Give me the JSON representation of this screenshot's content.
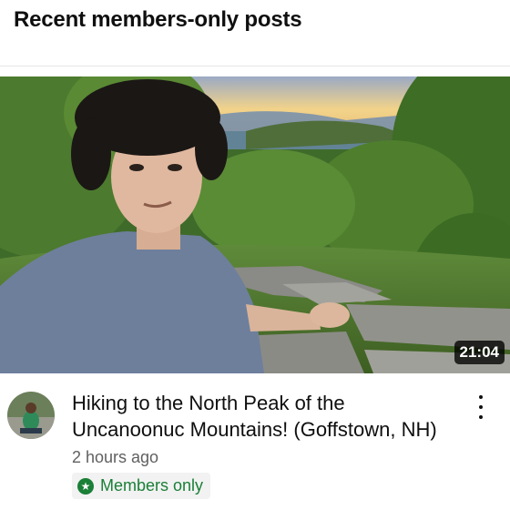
{
  "section": {
    "title": "Recent members-only posts"
  },
  "video": {
    "title": "Hiking to the North Peak of the Uncanoonuc Mountains! (Goffstown, NH)",
    "duration": "21:04",
    "posted": "2 hours ago",
    "badge": "Members only",
    "thumbnail_icon": "video-thumbnail",
    "avatar_icon": "channel-avatar",
    "menu_icon": "more-vert-icon"
  },
  "colors": {
    "badge_green": "#1a7f37",
    "text": "#0f0f0f",
    "secondary_text": "#606060"
  }
}
